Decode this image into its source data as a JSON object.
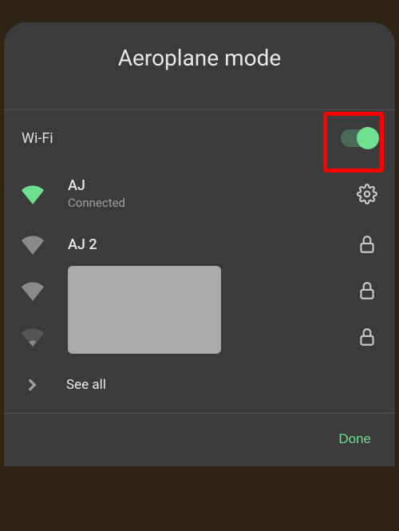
{
  "header": {
    "title": "Aeroplane mode"
  },
  "wifi": {
    "label": "Wi-Fi",
    "enabled": true
  },
  "networks": [
    {
      "name": "AJ",
      "status": "Connected",
      "signal": "full",
      "active": true,
      "action": "settings"
    },
    {
      "name": "AJ 2",
      "status": "",
      "signal": "full",
      "active": false,
      "action": "lock"
    },
    {
      "name": "",
      "status": "",
      "signal": "full",
      "active": false,
      "action": "lock",
      "redacted": true
    },
    {
      "name": "",
      "status": "",
      "signal": "low",
      "active": false,
      "action": "lock",
      "redacted": true
    }
  ],
  "seeAll": {
    "label": "See all"
  },
  "footer": {
    "done": "Done"
  },
  "colors": {
    "accent": "#6ee090",
    "panel": "#3b3b3b",
    "text": "#e8e8e8",
    "muted": "#9e9e9e"
  }
}
